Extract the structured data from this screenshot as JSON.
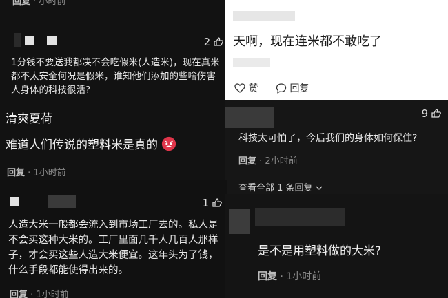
{
  "p1": {
    "top_reply": "回复",
    "top_time": "·  小时前",
    "c1_likes": "2",
    "c1_text": "1分钱不要送我都决不会吃假米(人造米)，现在真米都不太安全何况是假米，谁知他们添加的些啥伤害人身体的科技很活?",
    "c2_user": "清爽夏荷",
    "c2_text": "难道人们传说的塑料米是真的",
    "c2_reply": "回复",
    "c2_time": "·  1小时前"
  },
  "p2": {
    "comment": "天啊，现在连米都不敢吃了",
    "like_label": "赞",
    "reply_label": "回复"
  },
  "p3": {
    "likes": "9",
    "text": "科技太可怕了，今后我们的身体如何保住?",
    "reply": "回复",
    "time": "·  2小时前",
    "view_all": "查看全部 1 条回复"
  },
  "p4": {
    "likes": "1",
    "text": "人造大米一般都会流入到市场工厂去的。私人是不会买这种大米的。工厂里面几千人几百人那样子，才会买这些人造大米便宜。这年头为了钱，什么手段都能使得出来的。",
    "reply": "回复",
    "time": "·  1小时前"
  },
  "p5": {
    "text": "是不是用塑料做的大米?",
    "reply": "回复",
    "time": "·  1小时前"
  },
  "colors": {
    "dark_bg": "#111111",
    "light_bg": "#ffffff",
    "emoji": "#e0354a"
  },
  "icons": [
    "thumb-up-icon",
    "angry-face-emoji",
    "heart-icon",
    "comment-bubble-icon",
    "chevron-down-icon"
  ]
}
